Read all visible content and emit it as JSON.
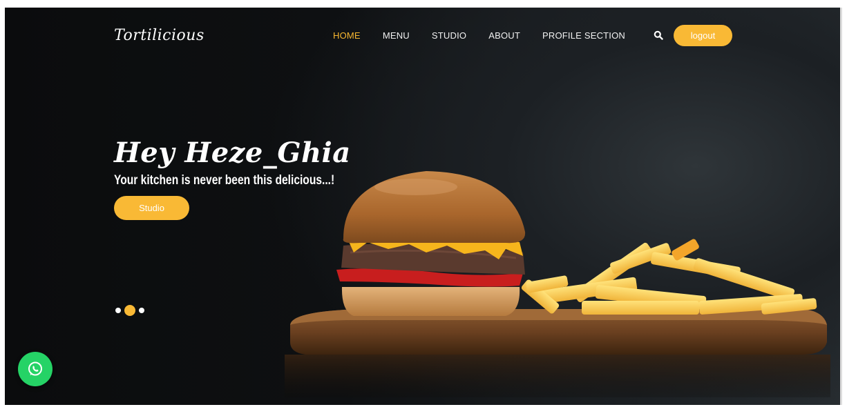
{
  "brand": {
    "logo_text": "Tortilicious",
    "accent_color": "#f9b935"
  },
  "nav": {
    "items": [
      {
        "label": "HOME",
        "active": true
      },
      {
        "label": "MENU",
        "active": false
      },
      {
        "label": "STUDIO",
        "active": false
      },
      {
        "label": "ABOUT",
        "active": false
      },
      {
        "label": "PROFILE SECTION",
        "active": false
      }
    ],
    "search_icon": "search-icon",
    "logout_label": "logout"
  },
  "hero": {
    "greeting": "Hey Heze_Ghia",
    "tagline": "Your kitchen is never been this delicious...!",
    "cta_label": "Studio",
    "image": "burger-and-fries-on-wooden-board"
  },
  "slider": {
    "count": 3,
    "active_index": 1
  },
  "floating": {
    "icon": "whatsapp-icon",
    "color": "#25d366"
  }
}
